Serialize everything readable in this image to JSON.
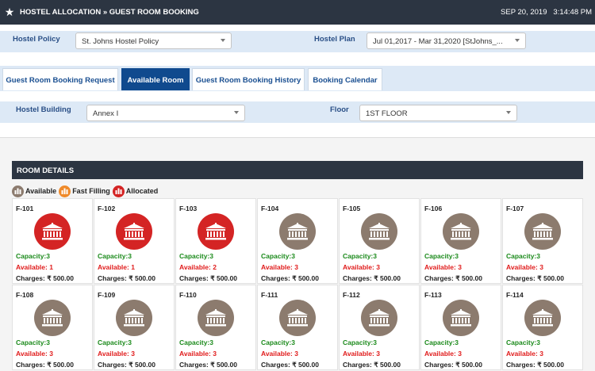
{
  "header": {
    "title": "HOSTEL ALLOCATION » GUEST ROOM BOOKING",
    "date": "SEP 20, 2019",
    "time": "3:14:48 PM",
    "icon": "star-icon"
  },
  "policy": {
    "hostel_policy_label": "Hostel Policy",
    "hostel_policy_value": "St. Johns Hostel Policy",
    "hostel_plan_label": "Hostel Plan",
    "hostel_plan_value": "Jul 01,2017 - Mar 31,2020 [StJohns_..."
  },
  "tabs": [
    {
      "label": "Guest Room Booking Request",
      "active": false
    },
    {
      "label": "Available Room",
      "active": true
    },
    {
      "label": "Guest Room Booking History",
      "active": false
    },
    {
      "label": "Booking Calendar",
      "active": false
    }
  ],
  "filters": {
    "building_label": "Hostel Building",
    "building_value": "Annex I",
    "floor_label": "Floor",
    "floor_value": "1ST FLOOR"
  },
  "room_details": {
    "title": "ROOM DETAILS",
    "legend": [
      {
        "label": "Available",
        "color": "#8c7b6e"
      },
      {
        "label": "Fast Filling",
        "color": "#ef8a2a"
      },
      {
        "label": "Allocated",
        "color": "#d42424"
      }
    ],
    "rooms": [
      {
        "number": "F-101",
        "status": "allocated",
        "capacity": "Capacity:3",
        "available": "Available: 1",
        "charges": "Charges: ₹ 500.00"
      },
      {
        "number": "F-102",
        "status": "allocated",
        "capacity": "Capacity:3",
        "available": "Available: 1",
        "charges": "Charges: ₹ 500.00"
      },
      {
        "number": "F-103",
        "status": "allocated",
        "capacity": "Capacity:3",
        "available": "Available: 2",
        "charges": "Charges: ₹ 500.00"
      },
      {
        "number": "F-104",
        "status": "available",
        "capacity": "Capacity:3",
        "available": "Available: 3",
        "charges": "Charges: ₹ 500.00"
      },
      {
        "number": "F-105",
        "status": "available",
        "capacity": "Capacity:3",
        "available": "Available: 3",
        "charges": "Charges: ₹ 500.00"
      },
      {
        "number": "F-106",
        "status": "available",
        "capacity": "Capacity:3",
        "available": "Available: 3",
        "charges": "Charges: ₹ 500.00"
      },
      {
        "number": "F-107",
        "status": "available",
        "capacity": "Capacity:3",
        "available": "Available: 3",
        "charges": "Charges: ₹ 500.00"
      },
      {
        "number": "F-108",
        "status": "available",
        "capacity": "Capacity:3",
        "available": "Available: 3",
        "charges": "Charges: ₹ 500.00"
      },
      {
        "number": "F-109",
        "status": "available",
        "capacity": "Capacity:3",
        "available": "Available: 3",
        "charges": "Charges: ₹ 500.00"
      },
      {
        "number": "F-110",
        "status": "available",
        "capacity": "Capacity:3",
        "available": "Available: 3",
        "charges": "Charges: ₹ 500.00"
      },
      {
        "number": "F-111",
        "status": "available",
        "capacity": "Capacity:3",
        "available": "Available: 3",
        "charges": "Charges: ₹ 500.00"
      },
      {
        "number": "F-112",
        "status": "available",
        "capacity": "Capacity:3",
        "available": "Available: 3",
        "charges": "Charges: ₹ 500.00"
      },
      {
        "number": "F-113",
        "status": "available",
        "capacity": "Capacity:3",
        "available": "Available: 3",
        "charges": "Charges: ₹ 500.00"
      },
      {
        "number": "F-114",
        "status": "available",
        "capacity": "Capacity:3",
        "available": "Available: 3",
        "charges": "Charges: ₹ 500.00"
      }
    ]
  },
  "colors": {
    "header_bg": "#2c3542",
    "accent_blue": "#104a8e",
    "available": "#8c7b6e",
    "allocated": "#d42424",
    "fast_filling": "#ef8a2a",
    "capacity_text": "#1b8a1b",
    "available_text": "#e01b1b"
  }
}
